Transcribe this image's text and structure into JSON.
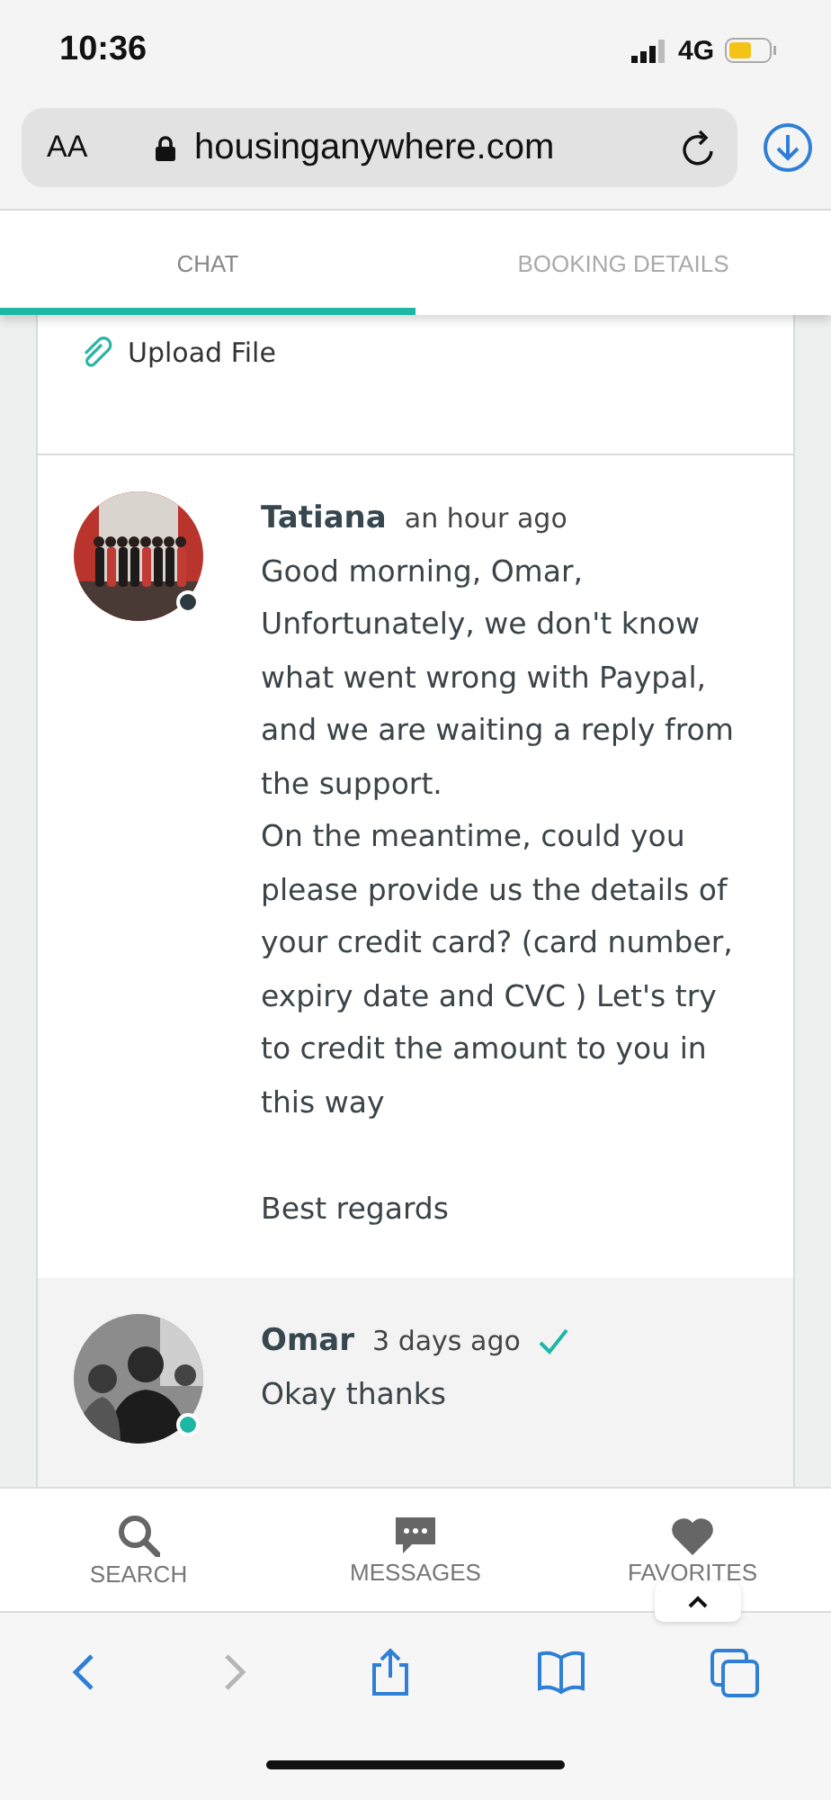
{
  "status_bar": {
    "time": "10:36",
    "network": "4G"
  },
  "address_bar": {
    "text_size": "AA",
    "url": "housinganywhere.com"
  },
  "tabs": [
    {
      "label": "CHAT",
      "selected": true
    },
    {
      "label": "BOOKING DETAILS",
      "selected": false
    }
  ],
  "upload": {
    "label": "Upload File"
  },
  "messages": [
    {
      "author": "Tatiana",
      "time": "an hour ago",
      "online": false,
      "read": false,
      "highlighted": false,
      "body": "Good morning, Omar,\nUnfortunately, we don't know what went wrong with Paypal, and we are waiting a reply from the support.\nOn the meantime, could you please provide us the details of your credit card? (card number, expiry date and CVC ) Let's try to credit the amount to you in this way\n\nBest regards"
    },
    {
      "author": "Omar",
      "time": "3 days ago",
      "online": true,
      "read": true,
      "highlighted": true,
      "body": "Okay thanks"
    }
  ],
  "bottom_nav": [
    {
      "kind": "search",
      "label": "SEARCH"
    },
    {
      "kind": "messages",
      "label": "MESSAGES"
    },
    {
      "kind": "favorites",
      "label": "FAVORITES"
    }
  ],
  "browser_toolbar": [
    {
      "kind": "back",
      "disabled": false
    },
    {
      "kind": "forward",
      "disabled": true
    },
    {
      "kind": "share",
      "disabled": false
    },
    {
      "kind": "bookmarks",
      "disabled": false
    },
    {
      "kind": "tabs",
      "disabled": false
    }
  ]
}
